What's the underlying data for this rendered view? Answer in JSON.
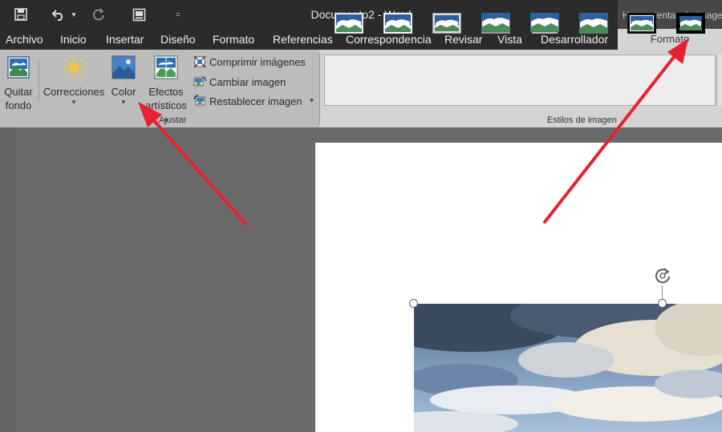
{
  "titlebar": {
    "document_title": "Documento2 - Word",
    "context_header": "Herramientas de imagen"
  },
  "qat": {
    "save_icon": "save-icon",
    "undo_icon": "undo-icon",
    "redo_icon": "redo-icon",
    "layout_icon": "page-layout-icon",
    "customize_icon": "customize-qat-icon"
  },
  "menu": {
    "items": [
      "Archivo",
      "Inicio",
      "Insertar",
      "Diseño",
      "Formato",
      "Referencias",
      "Correspondencia",
      "Revisar",
      "Vista",
      "Desarrollador"
    ],
    "context_tab": "Formato"
  },
  "ribbon": {
    "remove_background": {
      "line1": "Quitar",
      "line2": "fondo"
    },
    "corrections": {
      "label": "Correcciones"
    },
    "color": {
      "label": "Color"
    },
    "artistic_effects": {
      "line1": "Efectos",
      "line2": "artísticos"
    },
    "compress": {
      "label": "Comprimir imágenes"
    },
    "change": {
      "label": "Cambiar imagen"
    },
    "reset": {
      "label": "Restablecer imagen"
    },
    "adjust_group_label": "Ajustar",
    "styles_group_label": "Estilos de imagen"
  },
  "colors": {
    "titlebar": "#2b2b2b",
    "ribbon": "#bcbcbc",
    "canvas": "#6a6a6a",
    "arrow": "#e8212e"
  }
}
